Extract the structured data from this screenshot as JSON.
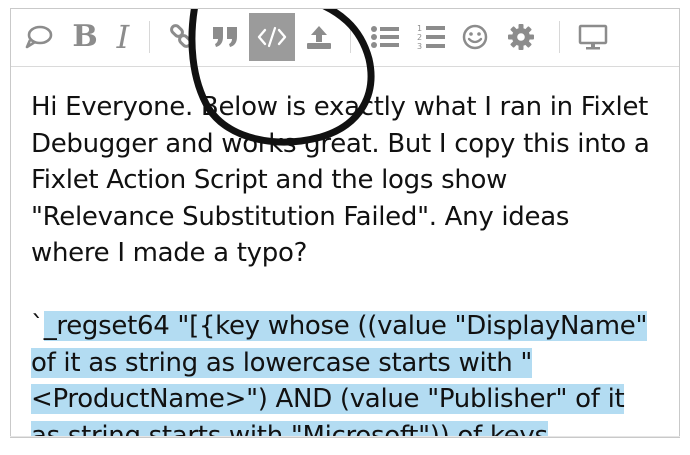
{
  "toolbar": {
    "buttons": [
      {
        "name": "comment",
        "icon": "speech-bubble-icon"
      },
      {
        "name": "bold",
        "label": "B"
      },
      {
        "name": "italic",
        "label": "I"
      },
      {
        "name": "link",
        "icon": "link-icon"
      },
      {
        "name": "quote",
        "icon": "quote-icon"
      },
      {
        "name": "code",
        "icon": "code-icon",
        "active": true
      },
      {
        "name": "upload",
        "icon": "upload-icon"
      },
      {
        "name": "bullet-list",
        "icon": "bullet-list-icon"
      },
      {
        "name": "numbered-list",
        "icon": "numbered-list-icon"
      },
      {
        "name": "emoji",
        "icon": "smiley-icon"
      },
      {
        "name": "settings",
        "icon": "gear-icon"
      },
      {
        "name": "preview",
        "icon": "monitor-icon"
      }
    ],
    "active_color": "#9b9b9b",
    "icon_color": "#8c8c8c"
  },
  "editor": {
    "paragraph_lines": [
      "Hi Everyone. Below is exactly what I ran in Fixlet",
      "Debugger and works great. But I copy this into a",
      "Fixlet Action Script and the logs show",
      "\"Relevance Substitution Failed\". Any ideas",
      "where I made a typo?"
    ],
    "code_prefix": "`",
    "code_lines": [
      "_regset64 \"[{key whose ((value \"DisplayName\"",
      "of it as string as lowercase starts with \"",
      "<ProductName>\") AND (value \"Publisher\" of it",
      "as string starts with \"Microsoft\")) of keys"
    ],
    "selection_color": "#b3dcf2"
  }
}
